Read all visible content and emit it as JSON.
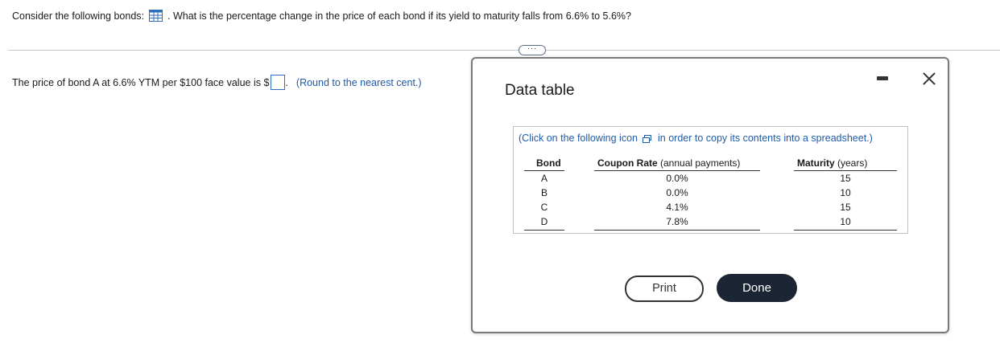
{
  "question": {
    "prefix": "Consider the following bonds:",
    "suffix": ". What is the percentage change in the price of each bond if its yield to maturity falls from 6.6% to 5.6%?"
  },
  "expand_label": "···",
  "answer": {
    "prefix": "The price of bond A at 6.6% YTM per $100 face value is $",
    "suffix": ".",
    "hint": "(Round to the nearest cent.)"
  },
  "dialog": {
    "title": "Data table",
    "copy_prefix": "(Click on the following icon",
    "copy_suffix": "in order to copy its contents into a spreadsheet.)",
    "headers": {
      "bond": "Bond",
      "coupon_bold": "Coupon Rate",
      "coupon_rest": " (annual payments)",
      "maturity_bold": "Maturity",
      "maturity_rest": " (years)"
    },
    "rows": [
      {
        "bond": "A",
        "coupon": "0.0%",
        "maturity": "15"
      },
      {
        "bond": "B",
        "coupon": "0.0%",
        "maturity": "10"
      },
      {
        "bond": "C",
        "coupon": "4.1%",
        "maturity": "15"
      },
      {
        "bond": "D",
        "coupon": "7.8%",
        "maturity": "10"
      }
    ],
    "print_label": "Print",
    "done_label": "Done"
  }
}
